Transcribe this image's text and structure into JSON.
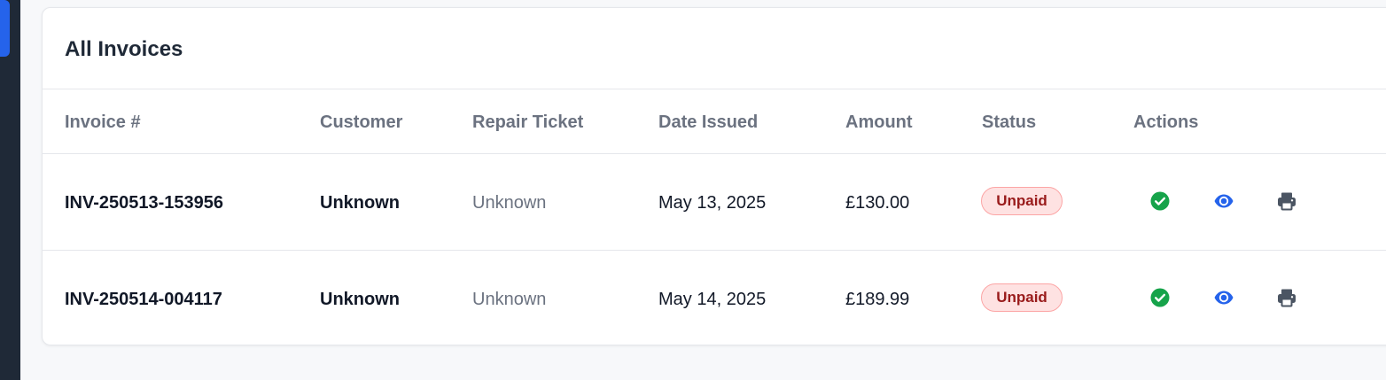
{
  "card": {
    "title": "All Invoices"
  },
  "table": {
    "headers": {
      "invoice": "Invoice #",
      "customer": "Customer",
      "ticket": "Repair Ticket",
      "date": "Date Issued",
      "amount": "Amount",
      "status": "Status",
      "actions": "Actions"
    },
    "rows": [
      {
        "invoice": "INV-250513-153956",
        "customer": "Unknown",
        "ticket": "Unknown",
        "date": "May 13, 2025",
        "amount": "£130.00",
        "status": "Unpaid"
      },
      {
        "invoice": "INV-250514-004117",
        "customer": "Unknown",
        "ticket": "Unknown",
        "date": "May 14, 2025",
        "amount": "£189.99",
        "status": "Unpaid"
      }
    ]
  },
  "icons": {
    "mark_paid": "check-circle-icon",
    "view": "eye-icon",
    "print": "printer-icon"
  },
  "colors": {
    "accent": "#2563eb",
    "paid_action": "#16a34a",
    "unpaid_badge_bg": "#fee2e2",
    "unpaid_badge_text": "#991b1b"
  }
}
